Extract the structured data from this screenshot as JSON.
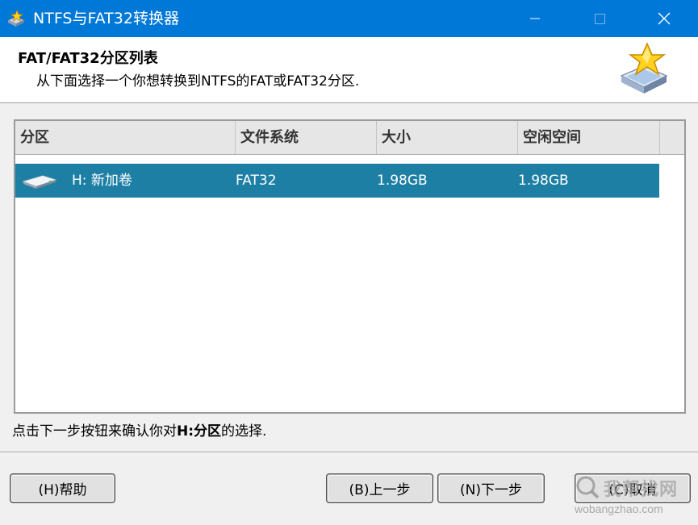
{
  "window": {
    "title": "NTFS与FAT32转换器",
    "controls": {
      "minimize": "—",
      "maximize": "☐",
      "close": "✕"
    }
  },
  "header": {
    "title": "FAT/FAT32分区列表",
    "subtitle": "从下面选择一个你想转换到NTFS的FAT或FAT32分区."
  },
  "partition_list": {
    "columns": [
      "分区",
      "文件系统",
      "大小",
      "空闲空间"
    ],
    "rows": [
      {
        "partition": "H: 新加卷",
        "file_system": "FAT32",
        "size": "1.98GB",
        "free_space": "1.98GB",
        "selected": true
      }
    ]
  },
  "status": {
    "prefix": "点击下一步按钮来确认你对",
    "emphasis": "H:分区",
    "suffix": "的选择."
  },
  "buttons": {
    "help": "(H)帮助",
    "back": "(B)上一步",
    "next": "(N)下一步",
    "cancel": "(C)取消"
  },
  "watermark": {
    "text": "我帮找网",
    "url": "wobangzhao.com"
  },
  "colors": {
    "titlebar": "#0078d7",
    "selection": "#1e7fa5",
    "background": "#f0f0f0"
  }
}
